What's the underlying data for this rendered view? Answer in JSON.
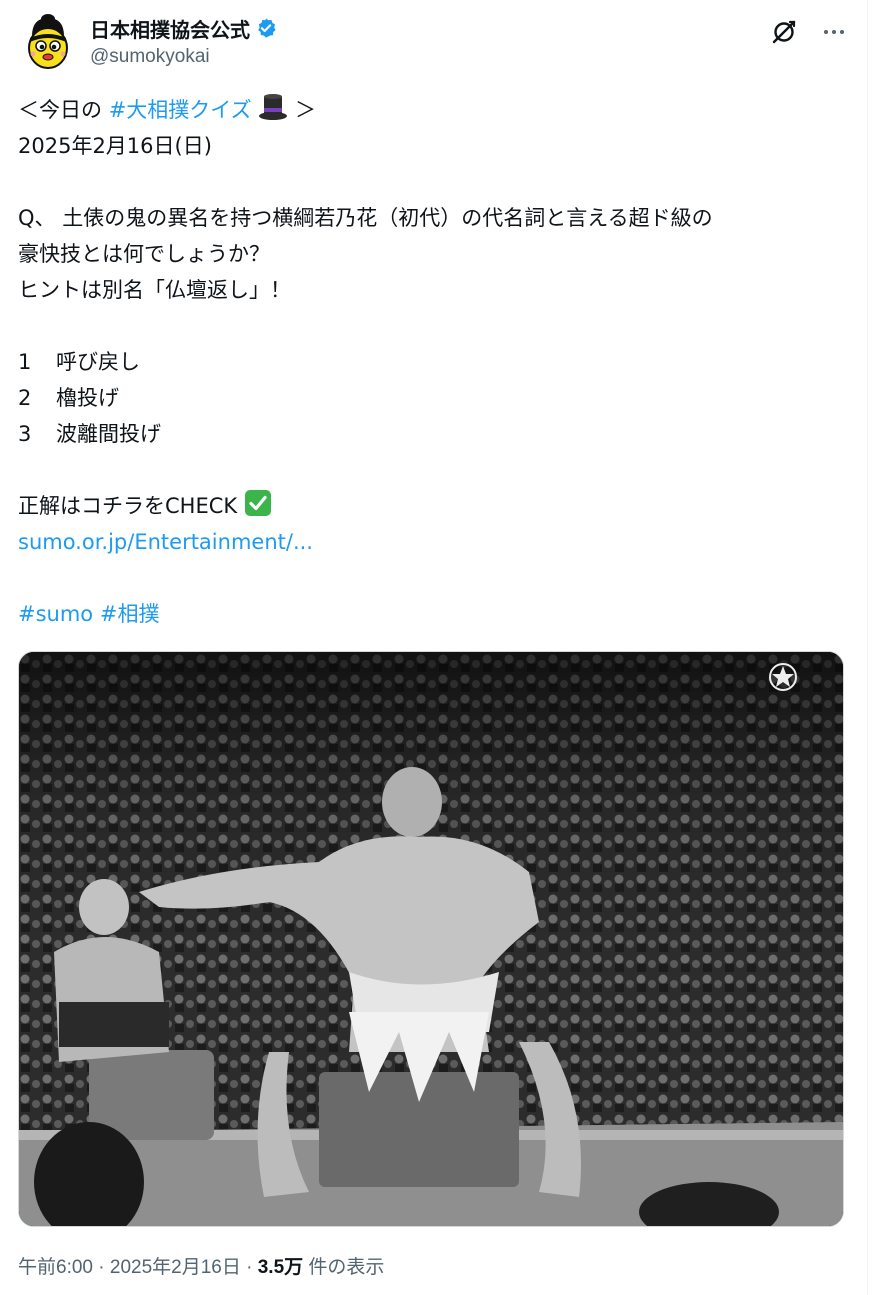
{
  "account": {
    "display_name": "日本相撲協会公式",
    "handle": "@sumokyokai",
    "avatar_icon": "sumo-mascot-avatar",
    "verified_icon": "verified-badge-icon"
  },
  "actions": {
    "grok_icon": "grok-icon",
    "more_icon": "more-options-icon"
  },
  "tweet": {
    "intro_open": "＜今日の ",
    "intro_hashtag": "#大相撲クイズ",
    "intro_emoji": "top-hat-emoji",
    "intro_close": " ＞",
    "date_line": "2025年2月16日(日)",
    "question_line1": "Q、 土俵の鬼の異名を持つ横綱若乃花（初代）の代名詞と言える超ド級の",
    "question_line2": "豪快技とは何でしょうか？",
    "hint_line": "ヒントは別名「仏壇返し」！",
    "options": [
      {
        "num": "1",
        "label": "呼び戻し"
      },
      {
        "num": "2",
        "label": "櫓投げ"
      },
      {
        "num": "3",
        "label": "波離間投げ"
      }
    ],
    "answer_text": "正解はコチラをCHECK",
    "answer_emoji": "check-mark-emoji",
    "link_text": "sumo.or.jp/Entertainment/...",
    "hashtags": [
      "#sumo",
      "#相撲"
    ]
  },
  "media": {
    "description_icon": "sumo-photo"
  },
  "meta": {
    "time": "午前6:00",
    "separator": " · ",
    "date": "2025年2月16日",
    "views_count": "3.5万",
    "views_label": " 件の表示"
  },
  "colors": {
    "link": "#1d9bf0",
    "text": "#0f1419",
    "secondary": "#536471",
    "verified": "#1d9bf0"
  }
}
